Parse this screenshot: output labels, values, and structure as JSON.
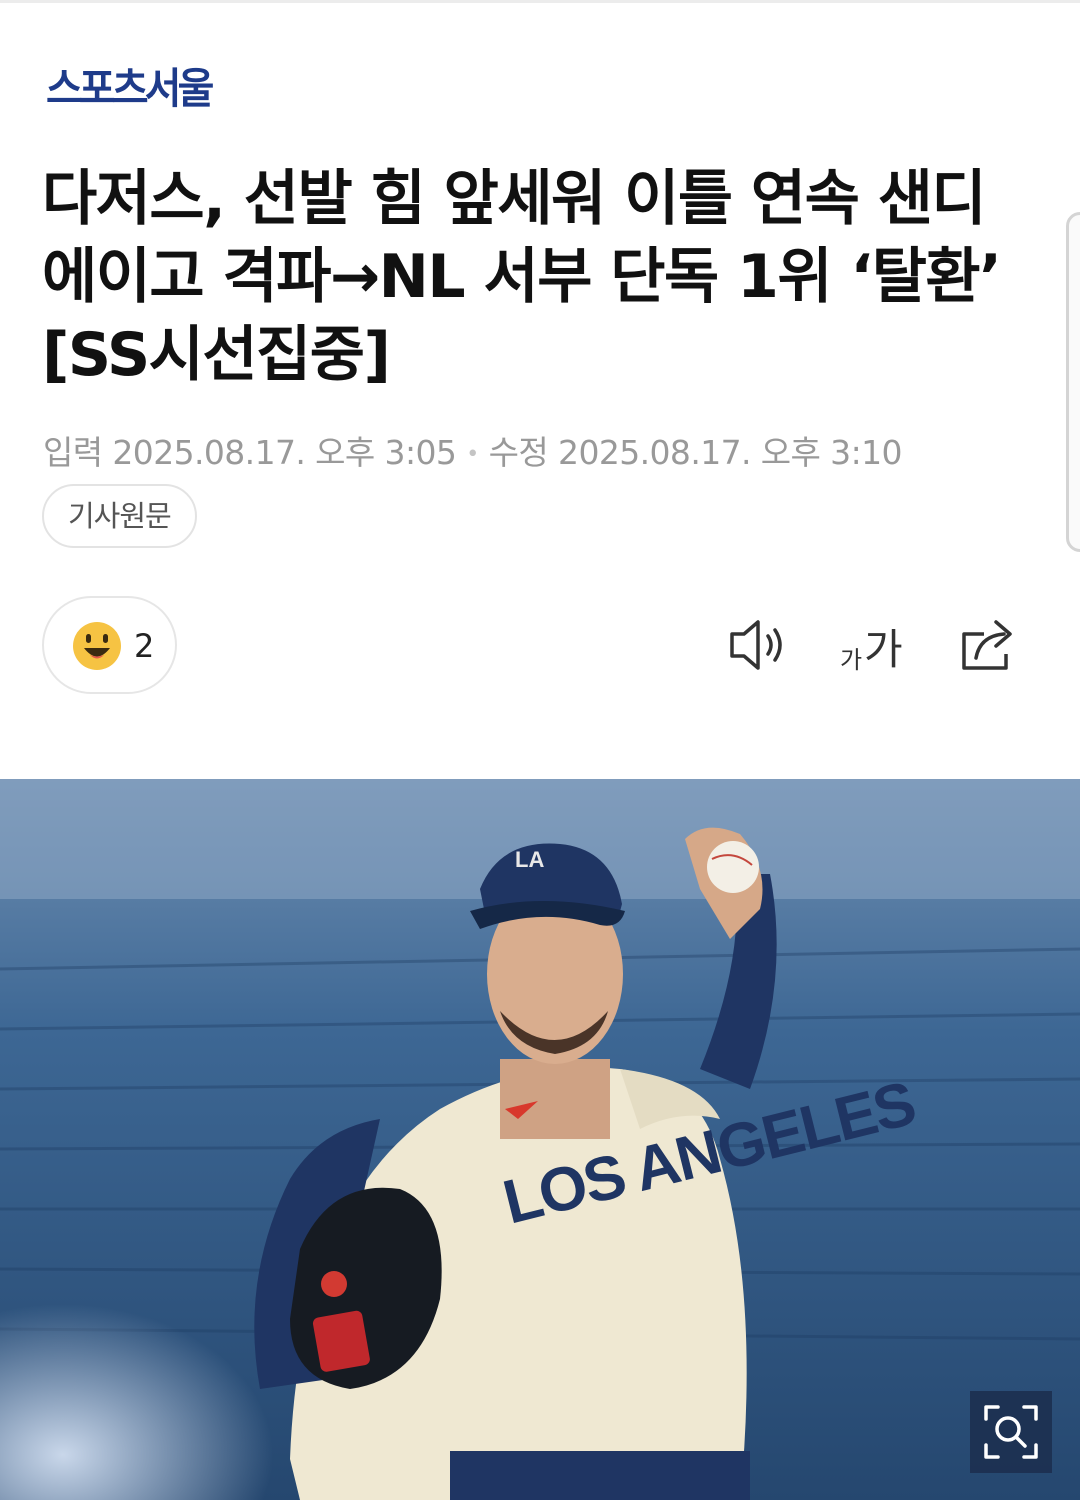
{
  "brand": {
    "name": "스포츠서울"
  },
  "article": {
    "title": "다저스, 선발 힘 앞세워 이틀 연속 샌디에이고 격파→NL 서부 단독 1위 ‘탈환’ [SS시선집중]",
    "published": "입력 2025.08.17. 오후 3:05",
    "updated": "수정 2025.08.17. 오후 3:10",
    "original_button": "기사원문"
  },
  "reactions": {
    "count": "2",
    "emoji_icon": "smiling-face-icon"
  },
  "toolbar": {
    "listen_icon": "speaker-icon",
    "font_size_small": "가",
    "font_size_big": "가",
    "share_icon": "share-icon"
  },
  "hero_image": {
    "jersey_text": "LOS ANGELES",
    "zoom_icon": "zoom-icon"
  },
  "colors": {
    "brand": "#1e3b8a",
    "emoji": "#f6c343",
    "stadium_blue": "#3a5d86",
    "jersey": "#efe8d2",
    "cap": "#1f3563"
  }
}
